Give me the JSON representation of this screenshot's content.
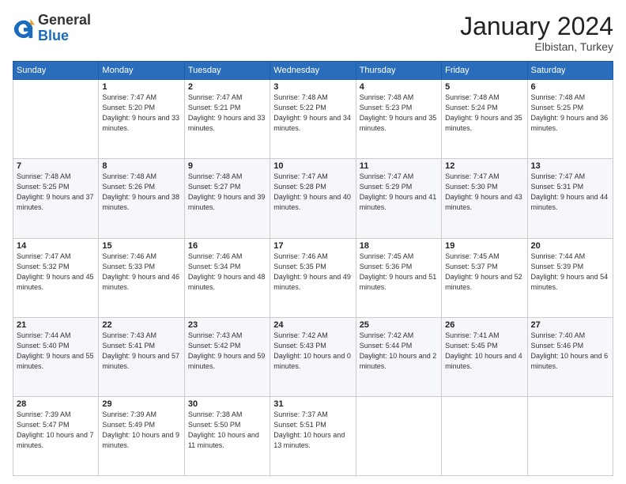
{
  "logo": {
    "general": "General",
    "blue": "Blue"
  },
  "header": {
    "month": "January 2024",
    "location": "Elbistan, Turkey"
  },
  "weekdays": [
    "Sunday",
    "Monday",
    "Tuesday",
    "Wednesday",
    "Thursday",
    "Friday",
    "Saturday"
  ],
  "weeks": [
    [
      {
        "day": "",
        "sunrise": "",
        "sunset": "",
        "daylight": ""
      },
      {
        "day": "1",
        "sunrise": "Sunrise: 7:47 AM",
        "sunset": "Sunset: 5:20 PM",
        "daylight": "Daylight: 9 hours and 33 minutes."
      },
      {
        "day": "2",
        "sunrise": "Sunrise: 7:47 AM",
        "sunset": "Sunset: 5:21 PM",
        "daylight": "Daylight: 9 hours and 33 minutes."
      },
      {
        "day": "3",
        "sunrise": "Sunrise: 7:48 AM",
        "sunset": "Sunset: 5:22 PM",
        "daylight": "Daylight: 9 hours and 34 minutes."
      },
      {
        "day": "4",
        "sunrise": "Sunrise: 7:48 AM",
        "sunset": "Sunset: 5:23 PM",
        "daylight": "Daylight: 9 hours and 35 minutes."
      },
      {
        "day": "5",
        "sunrise": "Sunrise: 7:48 AM",
        "sunset": "Sunset: 5:24 PM",
        "daylight": "Daylight: 9 hours and 35 minutes."
      },
      {
        "day": "6",
        "sunrise": "Sunrise: 7:48 AM",
        "sunset": "Sunset: 5:25 PM",
        "daylight": "Daylight: 9 hours and 36 minutes."
      }
    ],
    [
      {
        "day": "7",
        "sunrise": "Sunrise: 7:48 AM",
        "sunset": "Sunset: 5:25 PM",
        "daylight": "Daylight: 9 hours and 37 minutes."
      },
      {
        "day": "8",
        "sunrise": "Sunrise: 7:48 AM",
        "sunset": "Sunset: 5:26 PM",
        "daylight": "Daylight: 9 hours and 38 minutes."
      },
      {
        "day": "9",
        "sunrise": "Sunrise: 7:48 AM",
        "sunset": "Sunset: 5:27 PM",
        "daylight": "Daylight: 9 hours and 39 minutes."
      },
      {
        "day": "10",
        "sunrise": "Sunrise: 7:47 AM",
        "sunset": "Sunset: 5:28 PM",
        "daylight": "Daylight: 9 hours and 40 minutes."
      },
      {
        "day": "11",
        "sunrise": "Sunrise: 7:47 AM",
        "sunset": "Sunset: 5:29 PM",
        "daylight": "Daylight: 9 hours and 41 minutes."
      },
      {
        "day": "12",
        "sunrise": "Sunrise: 7:47 AM",
        "sunset": "Sunset: 5:30 PM",
        "daylight": "Daylight: 9 hours and 43 minutes."
      },
      {
        "day": "13",
        "sunrise": "Sunrise: 7:47 AM",
        "sunset": "Sunset: 5:31 PM",
        "daylight": "Daylight: 9 hours and 44 minutes."
      }
    ],
    [
      {
        "day": "14",
        "sunrise": "Sunrise: 7:47 AM",
        "sunset": "Sunset: 5:32 PM",
        "daylight": "Daylight: 9 hours and 45 minutes."
      },
      {
        "day": "15",
        "sunrise": "Sunrise: 7:46 AM",
        "sunset": "Sunset: 5:33 PM",
        "daylight": "Daylight: 9 hours and 46 minutes."
      },
      {
        "day": "16",
        "sunrise": "Sunrise: 7:46 AM",
        "sunset": "Sunset: 5:34 PM",
        "daylight": "Daylight: 9 hours and 48 minutes."
      },
      {
        "day": "17",
        "sunrise": "Sunrise: 7:46 AM",
        "sunset": "Sunset: 5:35 PM",
        "daylight": "Daylight: 9 hours and 49 minutes."
      },
      {
        "day": "18",
        "sunrise": "Sunrise: 7:45 AM",
        "sunset": "Sunset: 5:36 PM",
        "daylight": "Daylight: 9 hours and 51 minutes."
      },
      {
        "day": "19",
        "sunrise": "Sunrise: 7:45 AM",
        "sunset": "Sunset: 5:37 PM",
        "daylight": "Daylight: 9 hours and 52 minutes."
      },
      {
        "day": "20",
        "sunrise": "Sunrise: 7:44 AM",
        "sunset": "Sunset: 5:39 PM",
        "daylight": "Daylight: 9 hours and 54 minutes."
      }
    ],
    [
      {
        "day": "21",
        "sunrise": "Sunrise: 7:44 AM",
        "sunset": "Sunset: 5:40 PM",
        "daylight": "Daylight: 9 hours and 55 minutes."
      },
      {
        "day": "22",
        "sunrise": "Sunrise: 7:43 AM",
        "sunset": "Sunset: 5:41 PM",
        "daylight": "Daylight: 9 hours and 57 minutes."
      },
      {
        "day": "23",
        "sunrise": "Sunrise: 7:43 AM",
        "sunset": "Sunset: 5:42 PM",
        "daylight": "Daylight: 9 hours and 59 minutes."
      },
      {
        "day": "24",
        "sunrise": "Sunrise: 7:42 AM",
        "sunset": "Sunset: 5:43 PM",
        "daylight": "Daylight: 10 hours and 0 minutes."
      },
      {
        "day": "25",
        "sunrise": "Sunrise: 7:42 AM",
        "sunset": "Sunset: 5:44 PM",
        "daylight": "Daylight: 10 hours and 2 minutes."
      },
      {
        "day": "26",
        "sunrise": "Sunrise: 7:41 AM",
        "sunset": "Sunset: 5:45 PM",
        "daylight": "Daylight: 10 hours and 4 minutes."
      },
      {
        "day": "27",
        "sunrise": "Sunrise: 7:40 AM",
        "sunset": "Sunset: 5:46 PM",
        "daylight": "Daylight: 10 hours and 6 minutes."
      }
    ],
    [
      {
        "day": "28",
        "sunrise": "Sunrise: 7:39 AM",
        "sunset": "Sunset: 5:47 PM",
        "daylight": "Daylight: 10 hours and 7 minutes."
      },
      {
        "day": "29",
        "sunrise": "Sunrise: 7:39 AM",
        "sunset": "Sunset: 5:49 PM",
        "daylight": "Daylight: 10 hours and 9 minutes."
      },
      {
        "day": "30",
        "sunrise": "Sunrise: 7:38 AM",
        "sunset": "Sunset: 5:50 PM",
        "daylight": "Daylight: 10 hours and 11 minutes."
      },
      {
        "day": "31",
        "sunrise": "Sunrise: 7:37 AM",
        "sunset": "Sunset: 5:51 PM",
        "daylight": "Daylight: 10 hours and 13 minutes."
      },
      {
        "day": "",
        "sunrise": "",
        "sunset": "",
        "daylight": ""
      },
      {
        "day": "",
        "sunrise": "",
        "sunset": "",
        "daylight": ""
      },
      {
        "day": "",
        "sunrise": "",
        "sunset": "",
        "daylight": ""
      }
    ]
  ]
}
